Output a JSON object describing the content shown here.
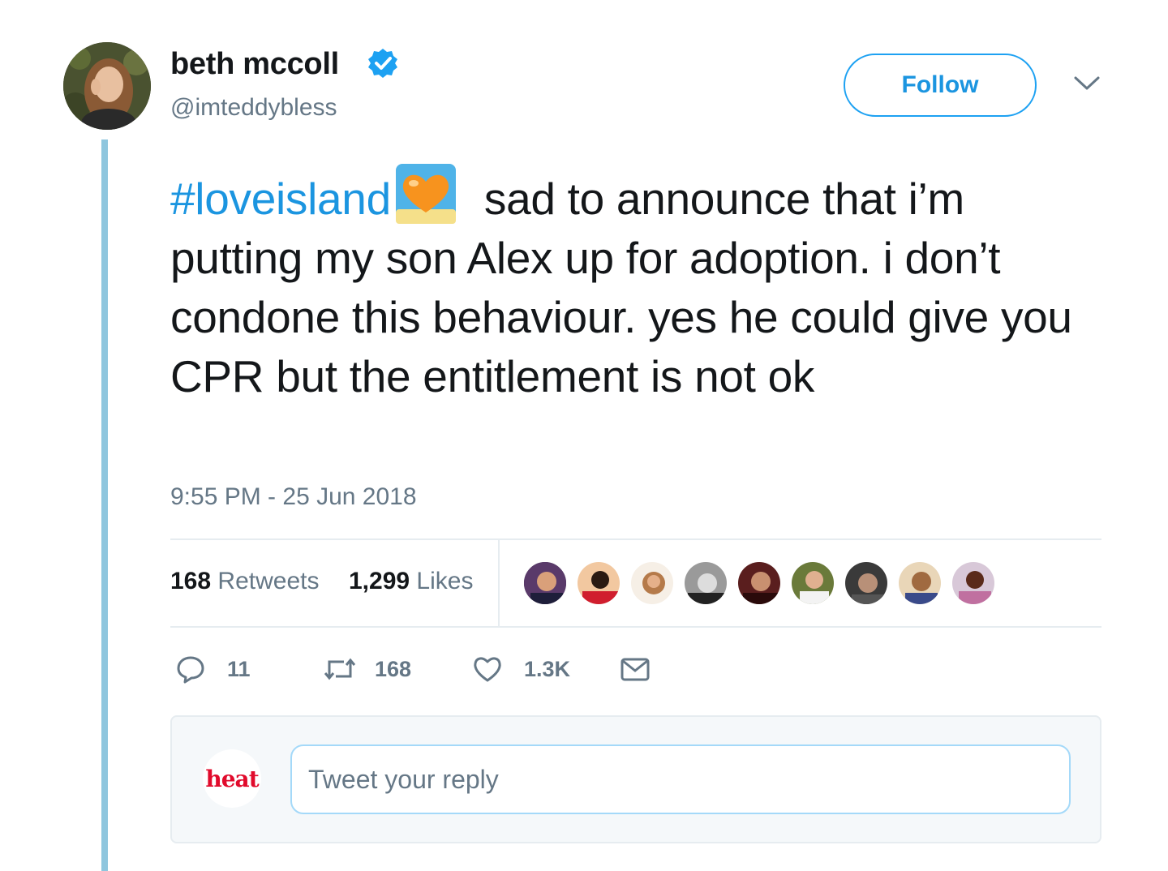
{
  "author": {
    "name": "beth mccoll",
    "handle": "@imteddybless",
    "verified": true
  },
  "follow_label": "Follow",
  "tweet": {
    "hashtag": "#loveisland",
    "emoji": "orange-heart-emoji",
    "text_line1": " sad to announce that i’m",
    "text_rest": "putting my son Alex up for adoption. i don’t condone this behaviour. yes he could give you CPR but the entitlement is not ok",
    "timestamp": "9:55 PM - 25 Jun 2018"
  },
  "stats": {
    "retweets_count": "168",
    "retweets_label": "Retweets",
    "likes_count": "1,299",
    "likes_label": "Likes"
  },
  "actions": {
    "reply_count": "11",
    "retweet_count": "168",
    "like_count": "1.3K"
  },
  "reply": {
    "avatar_text": "heat",
    "placeholder": "Tweet your reply"
  },
  "colors": {
    "accent": "#1da1f2",
    "link": "#1b95e0",
    "secondary_text": "#657786",
    "thread_line": "#8fc6de"
  }
}
